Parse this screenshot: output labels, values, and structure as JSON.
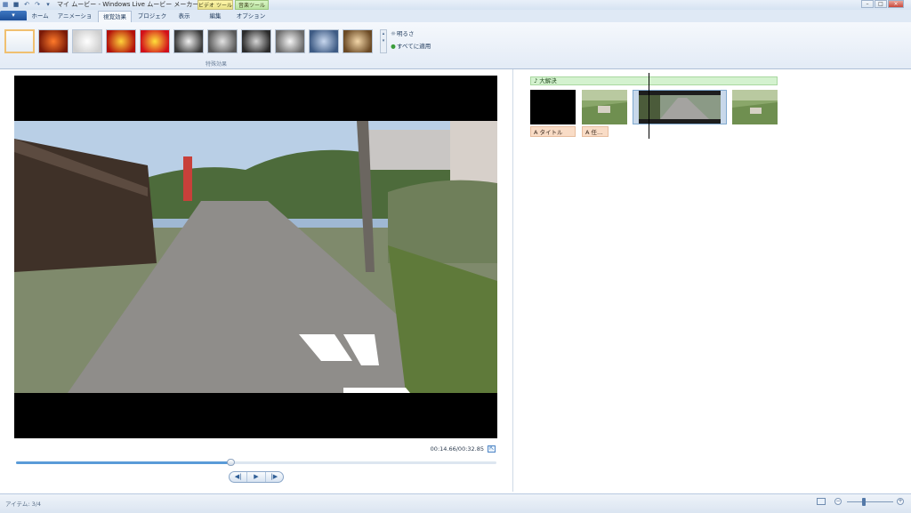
{
  "window": {
    "title": "マイ ムービー - Windows Live ムービー メーカー",
    "context_tabs": {
      "video_tools": "ビデオ ツール",
      "audio_tools": "音楽ツール"
    },
    "controls": {
      "minimize": "–",
      "maximize": "□",
      "close": "×"
    }
  },
  "quick_access": {
    "save_icon": "save-icon",
    "undo_icon": "undo-icon",
    "redo_icon": "redo-icon",
    "customize_icon": "chevron-down-icon"
  },
  "app_menu": {
    "label": "▾"
  },
  "tabs": [
    "ホーム",
    "アニメーション",
    "視覚効果",
    "プロジェクト",
    "表示",
    "編集",
    "オプション"
  ],
  "active_tab": "視覚効果",
  "ribbon": {
    "group_label": "特殊効果",
    "effects": [
      {
        "name": "none",
        "colors": [
          "#fbfcfe",
          "#dbe4ef"
        ]
      },
      {
        "name": "warm",
        "colors": [
          "#ff7a2a",
          "#7a1a08"
        ]
      },
      {
        "name": "sketch",
        "colors": [
          "#ffffff",
          "#cfcfcf"
        ]
      },
      {
        "name": "vivid",
        "colors": [
          "#ffd23a",
          "#b3120b"
        ]
      },
      {
        "name": "red-yellow",
        "colors": [
          "#ffe03a",
          "#d2101a"
        ]
      },
      {
        "name": "gray-1",
        "colors": [
          "#f0f0f0",
          "#3b3b3b"
        ]
      },
      {
        "name": "gray-2",
        "colors": [
          "#e2e2e2",
          "#5a5a5a"
        ]
      },
      {
        "name": "gray-3",
        "colors": [
          "#d5d5d5",
          "#2b2b2b"
        ]
      },
      {
        "name": "gray-4",
        "colors": [
          "#f5f5f5",
          "#6a6a6a"
        ]
      },
      {
        "name": "blue",
        "colors": [
          "#c7d7ee",
          "#3e5b84"
        ]
      },
      {
        "name": "sepia",
        "colors": [
          "#f2d6a8",
          "#6b4a25"
        ]
      }
    ],
    "brightness_label": "明るさ",
    "apply_all_label": "すべてに適用"
  },
  "preview": {
    "time": "00:14.66/00:32.85",
    "progress": 0.446,
    "controls": {
      "prev": "◀|",
      "play": "▶",
      "next": "|▶"
    },
    "fullscreen_icon": "fullscreen-icon"
  },
  "storyboard": {
    "music_label": "♪ 大解決",
    "captions": [
      "A タイトル",
      "A 任…"
    ]
  },
  "status": {
    "items": "アイテム: 3/4",
    "zoom_level": 0.37
  }
}
